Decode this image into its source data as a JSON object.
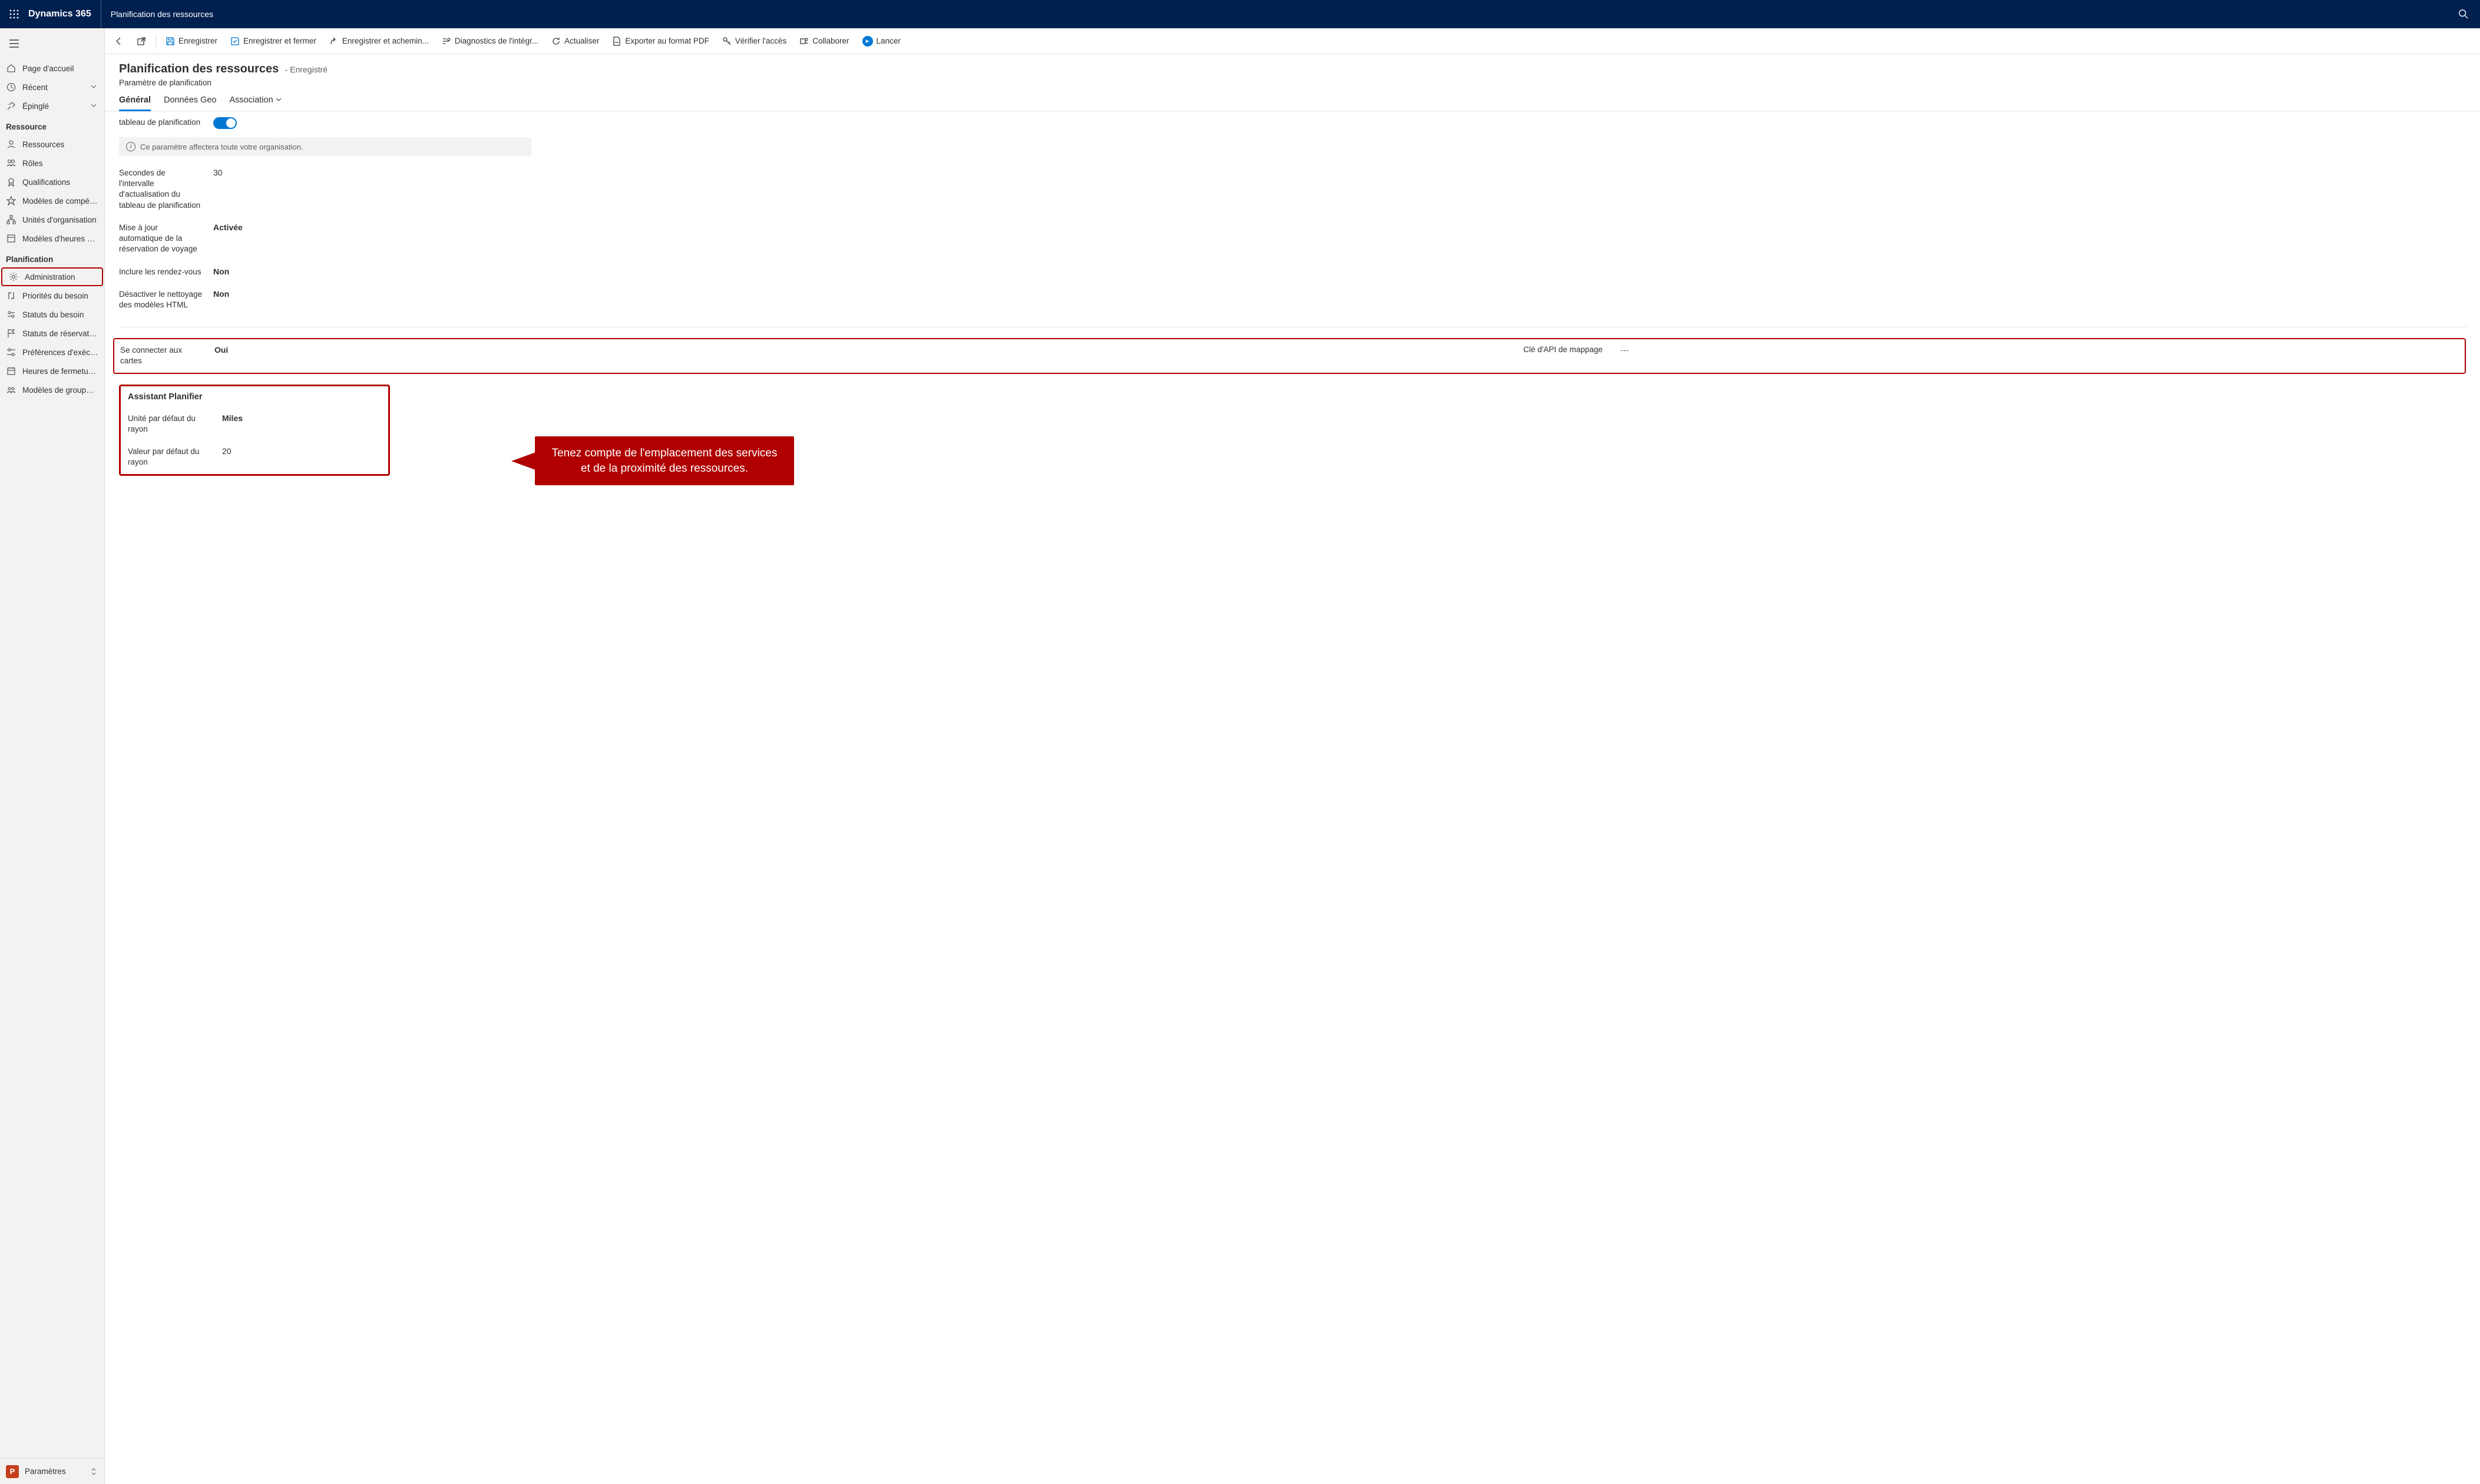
{
  "topbar": {
    "brand": "Dynamics 365",
    "area": "Planification des ressources"
  },
  "sidebar": {
    "items_top": [
      {
        "label": "Page d'accueil"
      },
      {
        "label": "Récent",
        "chevron": true
      },
      {
        "label": "Épinglé",
        "chevron": true
      }
    ],
    "group_resource": "Ressource",
    "items_resource": [
      {
        "label": "Ressources"
      },
      {
        "label": "Rôles"
      },
      {
        "label": "Qualifications"
      },
      {
        "label": "Modèles de compét..."
      },
      {
        "label": "Unités d'organisation"
      },
      {
        "label": "Modèles d'heures de..."
      }
    ],
    "group_planning": "Planification",
    "items_planning": [
      {
        "label": "Administration"
      },
      {
        "label": "Priorités du besoin"
      },
      {
        "label": "Statuts du besoin"
      },
      {
        "label": "Statuts de réservation"
      },
      {
        "label": "Préférences d'exécut..."
      },
      {
        "label": "Heures de fermeture..."
      },
      {
        "label": "Modèles de groupe ..."
      }
    ],
    "footer": "Paramètres",
    "footer_badge": "P"
  },
  "commands": {
    "save": "Enregistrer",
    "save_close": "Enregistrer et fermer",
    "save_route": "Enregistrer et achemin...",
    "integ_diag": "Diagnostics de l'intégr...",
    "refresh": "Actualiser",
    "export_pdf": "Exporter au format PDF",
    "check_access": "Vérifier l'accès",
    "collaborate": "Collaborer",
    "launch": "Lancer"
  },
  "header": {
    "title": "Planification des ressources",
    "state": "- Enregistré",
    "subtitle": "Paramètre de planification"
  },
  "tabs": {
    "general": "Général",
    "geo": "Données Geo",
    "assoc": "Association"
  },
  "form": {
    "toggle_label": "Activer le nouveau tableau de planification",
    "toggle_label_visible": "tableau de planification",
    "info": "Ce paramètre affectera toute votre organisation.",
    "refresh_seconds_label": "Secondes de l'intervalle d'actualisation du tableau de planification",
    "refresh_seconds_value": "30",
    "auto_update_label": "Mise à jour automatique de la réservation de voyage",
    "auto_update_value": "Activée",
    "include_appt_label": "Inclure les rendez-vous",
    "include_appt_value": "Non",
    "disable_html_label": "Désactiver le nettoyage des modèles HTML",
    "disable_html_value": "Non",
    "connect_maps_label": "Se connecter aux cartes",
    "connect_maps_value": "Oui",
    "map_api_key_label": "Clé d'API de mappage",
    "map_api_key_value": "---",
    "assistant_title": "Assistant Planifier",
    "radius_unit_label": "Unité par défaut du rayon",
    "radius_unit_value": "Miles",
    "radius_value_label": "Valeur par défaut du rayon",
    "radius_value_value": "20"
  },
  "callout": {
    "text": "Tenez compte de l'emplacement des services et de la proximité des ressources."
  }
}
